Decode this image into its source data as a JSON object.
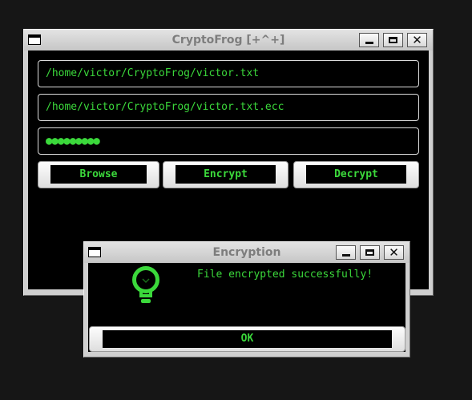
{
  "main_window": {
    "title": "CryptoFrog [+^+]",
    "input_file": "/home/victor/CryptoFrog/victor.txt",
    "output_file": "/home/victor/CryptoFrog/victor.txt.ecc",
    "password_mask": "●●●●●●●●●",
    "buttons": {
      "browse": "Browse",
      "encrypt": "Encrypt",
      "decrypt": "Decrypt"
    },
    "controls": {
      "minimize_icon": "minimize-icon",
      "maximize_icon": "maximize-icon",
      "close_glyph": "✕"
    }
  },
  "dialog": {
    "title": "Encryption",
    "message": "File encrypted successfully!",
    "icon": "lightbulb-icon",
    "ok_label": "OK",
    "close_glyph": "✕"
  },
  "colors": {
    "accent_green": "#3bd83b",
    "background": "#000000",
    "desktop": "#161616",
    "window_frame": "#cfcfcf"
  }
}
